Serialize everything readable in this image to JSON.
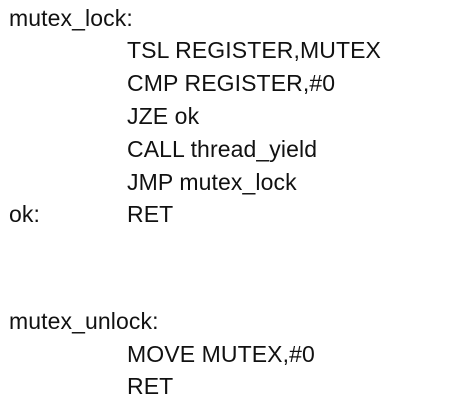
{
  "code": {
    "block1": {
      "label": "mutex_lock:",
      "instructions": [
        "TSL REGISTER,MUTEX",
        "CMP REGISTER,#0",
        "JZE ok",
        "CALL thread_yield",
        "JMP mutex_lock"
      ],
      "ok_label": "ok:",
      "ok_instruction": "RET"
    },
    "block2": {
      "label": "mutex_unlock:",
      "instructions": [
        "MOVE MUTEX,#0",
        "RET"
      ]
    }
  }
}
